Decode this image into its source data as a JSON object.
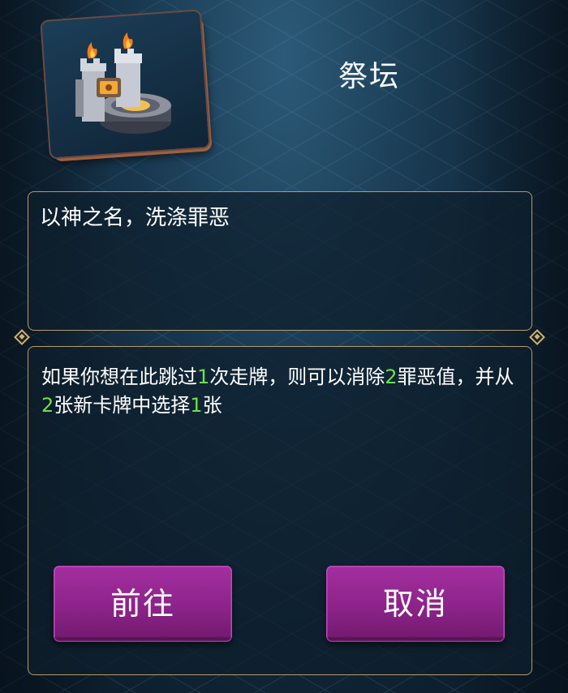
{
  "header": {
    "title": "祭坛",
    "icon": "altar-icon"
  },
  "panel_top": {
    "subtitle": "以神之名，洗涤罪恶"
  },
  "panel_bottom": {
    "description": [
      {
        "text": "如果你想在此跳过",
        "highlight": false
      },
      {
        "text": "1",
        "highlight": true
      },
      {
        "text": "次走牌，则可以消除",
        "highlight": false
      },
      {
        "text": "2",
        "highlight": true
      },
      {
        "text": "罪恶值，并从",
        "highlight": false
      },
      {
        "text": "2",
        "highlight": true
      },
      {
        "text": "张新卡牌中选择",
        "highlight": false
      },
      {
        "text": "1",
        "highlight": true
      },
      {
        "text": "张",
        "highlight": false
      }
    ]
  },
  "buttons": {
    "go_label": "前往",
    "cancel_label": "取消"
  },
  "colors": {
    "highlight": "#6fe04a",
    "button": "#8c2389",
    "border": "#b59a6e"
  }
}
